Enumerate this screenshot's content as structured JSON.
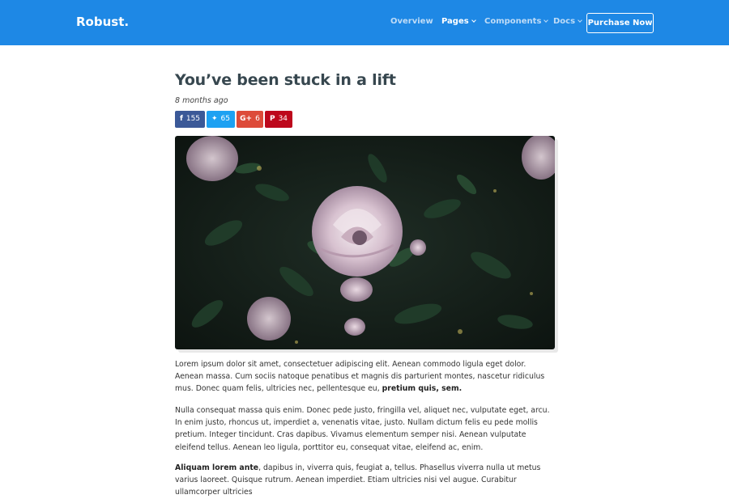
{
  "navbar": {
    "brand": "Robust.",
    "items": [
      {
        "label": "Overview",
        "has_caret": false,
        "active": false
      },
      {
        "label": "Pages",
        "has_caret": true,
        "active": true
      },
      {
        "label": "Components",
        "has_caret": true,
        "active": false
      },
      {
        "label": "Docs",
        "has_caret": true,
        "active": false
      }
    ],
    "purchase_label": "Purchase Now",
    "bg_color": "#1e88e5"
  },
  "article": {
    "title": "You’ve been stuck in a lift",
    "date": "8 months ago",
    "share": [
      {
        "network": "facebook",
        "icon": "facebook-icon",
        "glyph": "f",
        "count": "155",
        "color": "#3b5998"
      },
      {
        "network": "twitter",
        "icon": "twitter-icon",
        "glyph": "✦",
        "count": "65",
        "color": "#1da1f2"
      },
      {
        "network": "google-plus",
        "icon": "google-plus-icon",
        "glyph": "G+",
        "count": "6",
        "color": "#dd4b39"
      },
      {
        "network": "pinterest",
        "icon": "pinterest-icon",
        "glyph": "P",
        "count": "34",
        "color": "#bd081c"
      }
    ],
    "image": {
      "subject": "pale pink roses on dark foliage"
    },
    "paragraphs": [
      {
        "text": "Lorem ipsum dolor sit amet, consectetuer adipiscing elit. Aenean commodo ligula eget dolor. Aenean massa. Cum sociis natoque penatibus et magnis dis parturient montes, nascetur ridiculus mus. Donec quam felis, ultricies nec, pellentesque eu, ",
        "bold": "pretium quis, sem."
      },
      {
        "text": "Nulla consequat massa quis enim. Donec pede justo, fringilla vel, aliquet nec, vulputate eget, arcu. In enim justo, rhoncus ut, imperdiet a, venenatis vitae, justo. Nullam dictum felis eu pede mollis pretium. Integer tincidunt. Cras dapibus. Vivamus elementum semper nisi. Aenean vulputate eleifend tellus. Aenean leo ligula, porttitor eu, consequat vitae, eleifend ac, enim."
      },
      {
        "bold": "Aliquam lorem ante",
        "text": ", dapibus in, viverra quis, feugiat a, tellus. Phasellus viverra nulla ut metus varius laoreet. Quisque rutrum. Aenean imperdiet. Etiam ultricies nisi vel augue. Curabitur ullamcorper ultricies"
      }
    ]
  }
}
